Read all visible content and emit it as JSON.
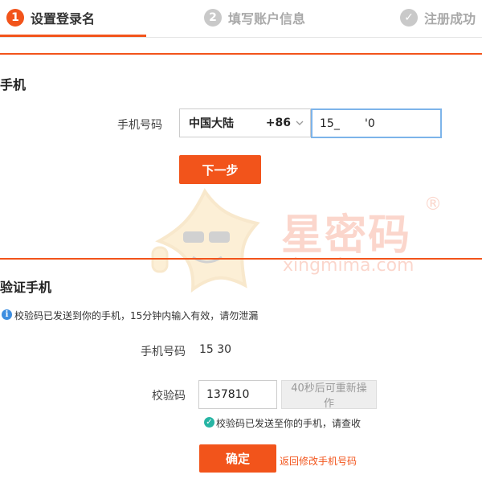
{
  "steps": [
    {
      "number": "1",
      "label": "设置登录名"
    },
    {
      "number": "2",
      "label": "填写账户信息"
    },
    {
      "icon": "check-circle-icon",
      "label": "注册成功"
    }
  ],
  "section1": {
    "title": "手机",
    "phone_label": "手机号码",
    "country": "中国大陆",
    "country_code": "+86",
    "phone_value": "15_       '0",
    "next_button": "下一步"
  },
  "watermark": {
    "brand": "星密码",
    "domain": "xingmima.com",
    "registered": "®"
  },
  "section2": {
    "title": "验证手机",
    "notice": "校验码已发送到你的手机，15分钟内输入有效，请勿泄漏",
    "phone_label": "手机号码",
    "phone_value": "15          30",
    "code_label": "校验码",
    "code_value": "137810",
    "resend_button": "40秒后可重新操作",
    "sent_message": "校验码已发送至你的手机，请查收",
    "confirm_button": "确定",
    "back_link": "返回修改手机号码"
  },
  "colors": {
    "accent": "#f2541b",
    "info": "#3d8ee0",
    "success": "#26b5a4",
    "input_focus": "#7db4ea"
  }
}
